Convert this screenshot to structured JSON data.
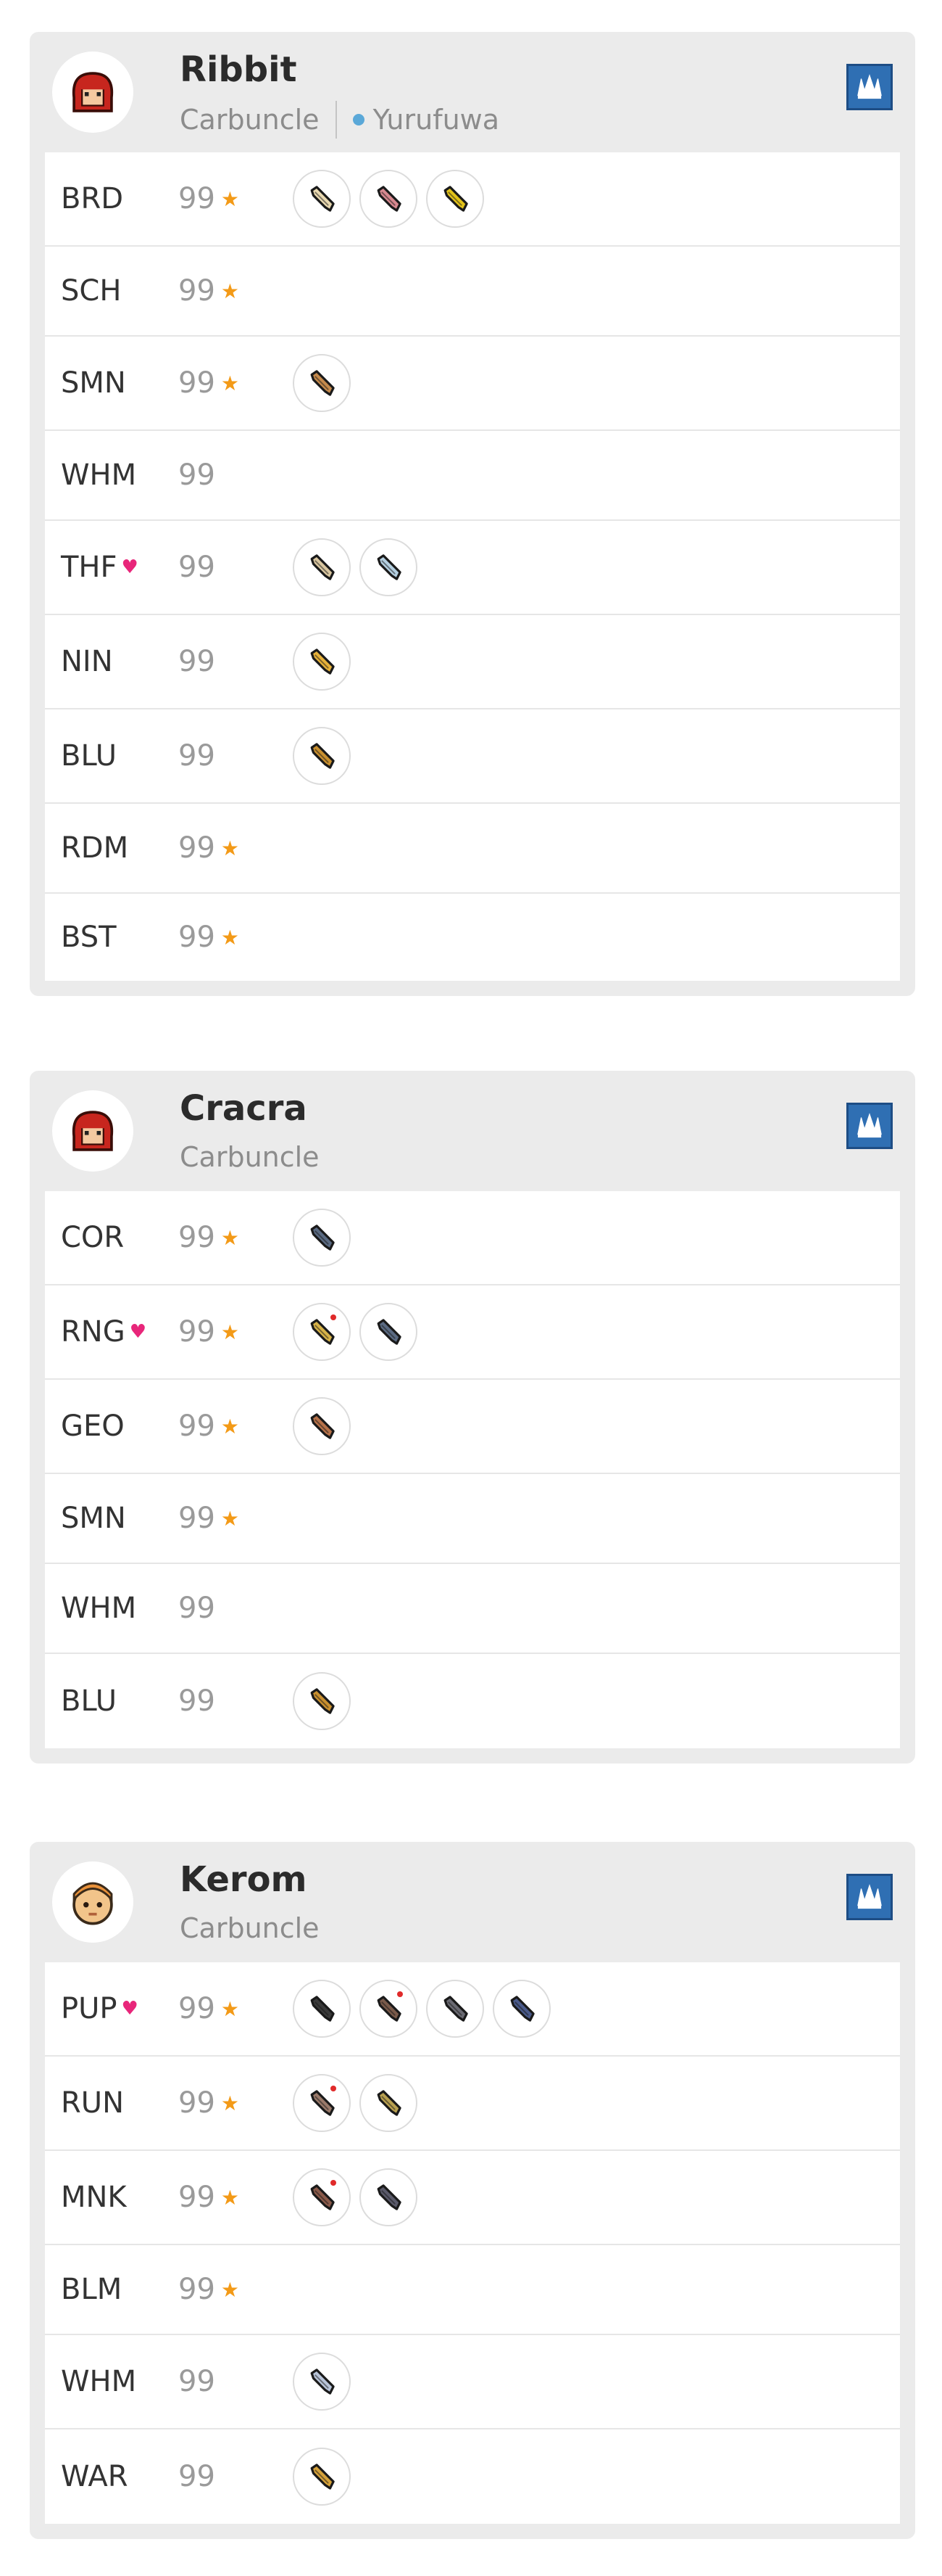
{
  "colors": {
    "card_bg": "#ebebeb",
    "row_bg": "#ffffff",
    "star": "#f39a17",
    "mastered": "#e8267a",
    "profile_button": "#2f6fb3",
    "linkshell_dot": "#5aa8d8"
  },
  "characters": [
    {
      "name": "Ribbit",
      "server": "Carbuncle",
      "linkshell": "Yurufuwa",
      "avatar_icon": "red-hair-avatar-icon",
      "profile_icon": "crystal-profile-icon",
      "jobs": [
        {
          "abbr": "BRD",
          "level": "99",
          "star": true,
          "mastered": false,
          "gear": [
            {
              "icon": "weapon-icon",
              "color": "#e8d8b0",
              "aug": false
            },
            {
              "icon": "weapon-icon",
              "color": "#d7888f",
              "aug": false
            },
            {
              "icon": "weapon-icon",
              "color": "#e2c21a",
              "aug": false
            }
          ]
        },
        {
          "abbr": "SCH",
          "level": "99",
          "star": true,
          "mastered": false,
          "gear": []
        },
        {
          "abbr": "SMN",
          "level": "99",
          "star": true,
          "mastered": false,
          "gear": [
            {
              "icon": "weapon-icon",
              "color": "#c58a4c",
              "aug": false
            }
          ]
        },
        {
          "abbr": "WHM",
          "level": "99",
          "star": false,
          "mastered": false,
          "gear": []
        },
        {
          "abbr": "THF",
          "level": "99",
          "star": false,
          "mastered": true,
          "gear": [
            {
              "icon": "weapon-icon",
              "color": "#d9c6a0",
              "aug": false
            },
            {
              "icon": "weapon-icon",
              "color": "#b4cfe0",
              "aug": false
            }
          ]
        },
        {
          "abbr": "NIN",
          "level": "99",
          "star": false,
          "mastered": false,
          "gear": [
            {
              "icon": "weapon-icon",
              "color": "#e6b13a",
              "aug": false
            }
          ]
        },
        {
          "abbr": "BLU",
          "level": "99",
          "star": false,
          "mastered": false,
          "gear": [
            {
              "icon": "weapon-icon",
              "color": "#c9902f",
              "aug": false
            }
          ]
        },
        {
          "abbr": "RDM",
          "level": "99",
          "star": true,
          "mastered": false,
          "gear": []
        },
        {
          "abbr": "BST",
          "level": "99",
          "star": true,
          "mastered": false,
          "gear": []
        }
      ]
    },
    {
      "name": "Cracra",
      "server": "Carbuncle",
      "linkshell": "",
      "avatar_icon": "red-hair-avatar-icon",
      "profile_icon": "crystal-profile-icon",
      "jobs": [
        {
          "abbr": "COR",
          "level": "99",
          "star": true,
          "mastered": false,
          "gear": [
            {
              "icon": "weapon-icon",
              "color": "#5a6a82",
              "aug": false
            }
          ]
        },
        {
          "abbr": "RNG",
          "level": "99",
          "star": true,
          "mastered": true,
          "gear": [
            {
              "icon": "weapon-icon",
              "color": "#d6b248",
              "aug": true
            },
            {
              "icon": "weapon-icon",
              "color": "#5a6a82",
              "aug": false
            }
          ]
        },
        {
          "abbr": "GEO",
          "level": "99",
          "star": true,
          "mastered": false,
          "gear": [
            {
              "icon": "weapon-icon",
              "color": "#b7724a",
              "aug": false
            }
          ]
        },
        {
          "abbr": "SMN",
          "level": "99",
          "star": true,
          "mastered": false,
          "gear": []
        },
        {
          "abbr": "WHM",
          "level": "99",
          "star": false,
          "mastered": false,
          "gear": []
        },
        {
          "abbr": "BLU",
          "level": "99",
          "star": false,
          "mastered": false,
          "gear": [
            {
              "icon": "weapon-icon",
              "color": "#c9902f",
              "aug": false
            }
          ]
        }
      ]
    },
    {
      "name": "Kerom",
      "server": "Carbuncle",
      "linkshell": "",
      "avatar_icon": "tarutaru-avatar-icon",
      "profile_icon": "crystal-profile-icon",
      "jobs": [
        {
          "abbr": "PUP",
          "level": "99",
          "star": true,
          "mastered": true,
          "gear": [
            {
              "icon": "weapon-icon",
              "color": "#3a3a3a",
              "aug": false
            },
            {
              "icon": "weapon-icon",
              "color": "#7a5a4a",
              "aug": true
            },
            {
              "icon": "weapon-icon",
              "color": "#6a6a72",
              "aug": false
            },
            {
              "icon": "weapon-icon",
              "color": "#4a5a8a",
              "aug": false
            }
          ]
        },
        {
          "abbr": "RUN",
          "level": "99",
          "star": true,
          "mastered": false,
          "gear": [
            {
              "icon": "weapon-icon",
              "color": "#9a7a6a",
              "aug": true
            },
            {
              "icon": "weapon-icon",
              "color": "#b8a050",
              "aug": false
            }
          ]
        },
        {
          "abbr": "MNK",
          "level": "99",
          "star": true,
          "mastered": false,
          "gear": [
            {
              "icon": "weapon-icon",
              "color": "#8a5a4a",
              "aug": true
            },
            {
              "icon": "weapon-icon",
              "color": "#5a5a6a",
              "aug": false
            }
          ]
        },
        {
          "abbr": "BLM",
          "level": "99",
          "star": true,
          "mastered": false,
          "gear": []
        },
        {
          "abbr": "WHM",
          "level": "99",
          "star": false,
          "mastered": false,
          "gear": [
            {
              "icon": "weapon-icon",
              "color": "#b8c4d8",
              "aug": false
            }
          ]
        },
        {
          "abbr": "WAR",
          "level": "99",
          "star": false,
          "mastered": false,
          "gear": [
            {
              "icon": "weapon-icon",
              "color": "#d6a23a",
              "aug": false
            }
          ]
        }
      ]
    }
  ]
}
